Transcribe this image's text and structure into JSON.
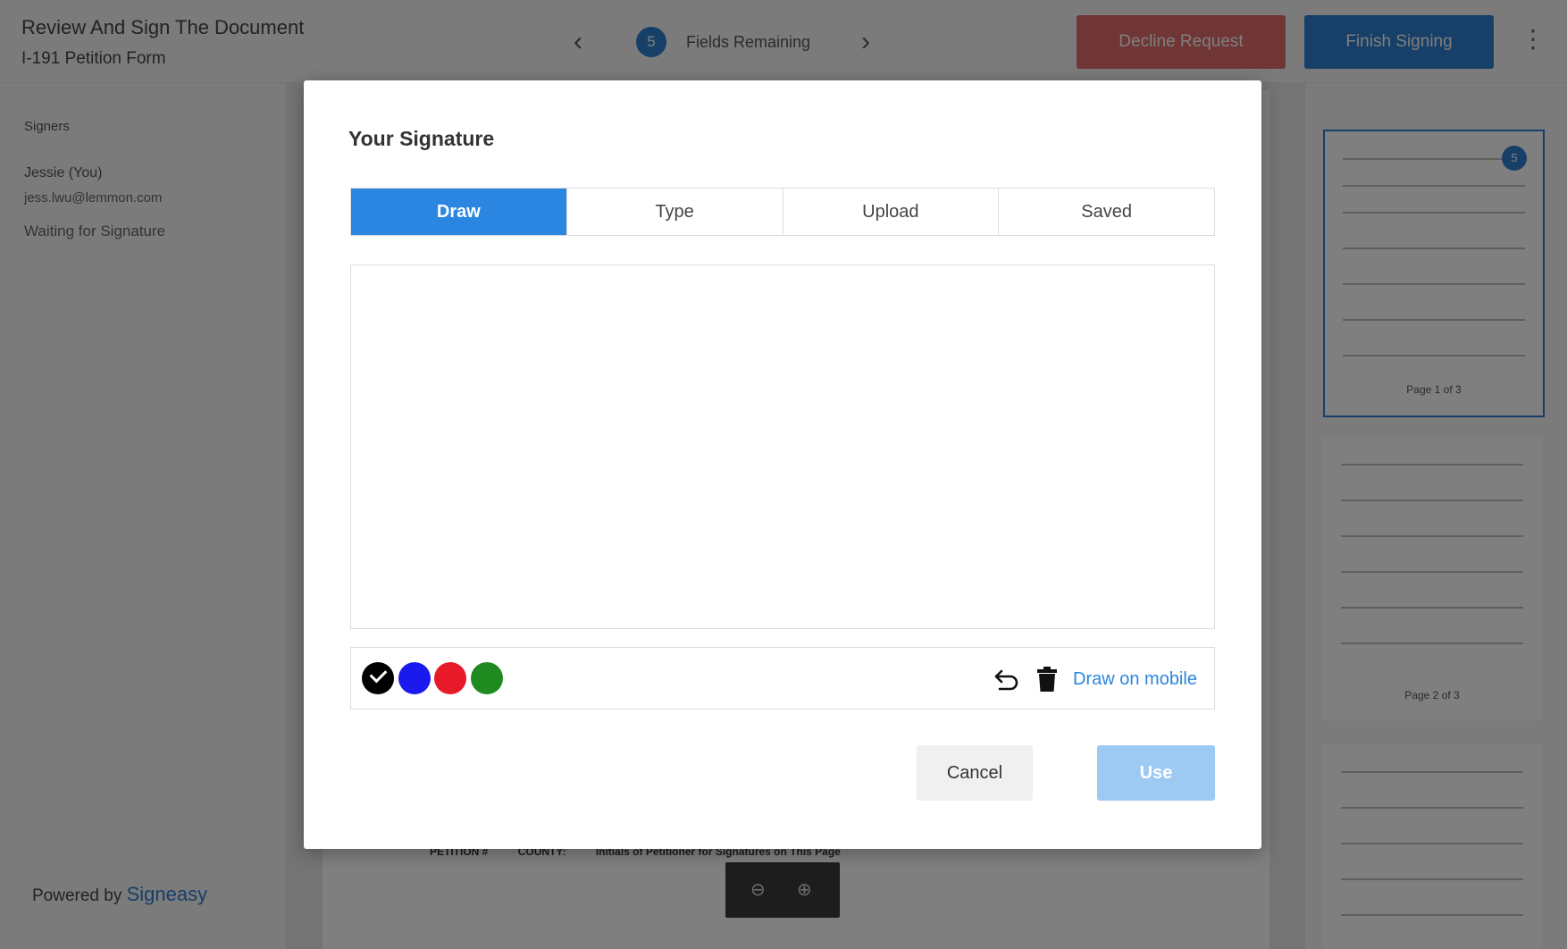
{
  "header": {
    "title": "Review And Sign The Document",
    "subtitle": "I-191 Petition Form",
    "fields_count": "5",
    "fields_label": "Fields Remaining",
    "decline_label": "Decline Request",
    "finish_label": "Finish Signing"
  },
  "sidebar": {
    "signers_label": "Signers",
    "signer_name": "Jessie (You)",
    "signer_email": "jess.lwu@lemmon.com",
    "signer_status": "Waiting for Signature",
    "powered_by": "Powered by",
    "brand": "Signeasy"
  },
  "document": {
    "footer_items": [
      "PETITION #",
      "COUNTY:",
      "Initials of Petitioner for Signatures on This Page"
    ]
  },
  "thumbnails": {
    "badge": "5",
    "page1_label": "Page 1 of 3",
    "page2_label": "Page 2 of 3"
  },
  "modal": {
    "title": "Your Signature",
    "tabs": [
      "Draw",
      "Type",
      "Upload",
      "Saved"
    ],
    "active_tab": "Draw",
    "colors": [
      "#000000",
      "#1a1aee",
      "#e81a2a",
      "#1f8a1f"
    ],
    "selected_color": "#000000",
    "draw_mobile_label": "Draw on mobile",
    "cancel_label": "Cancel",
    "use_label": "Use"
  }
}
